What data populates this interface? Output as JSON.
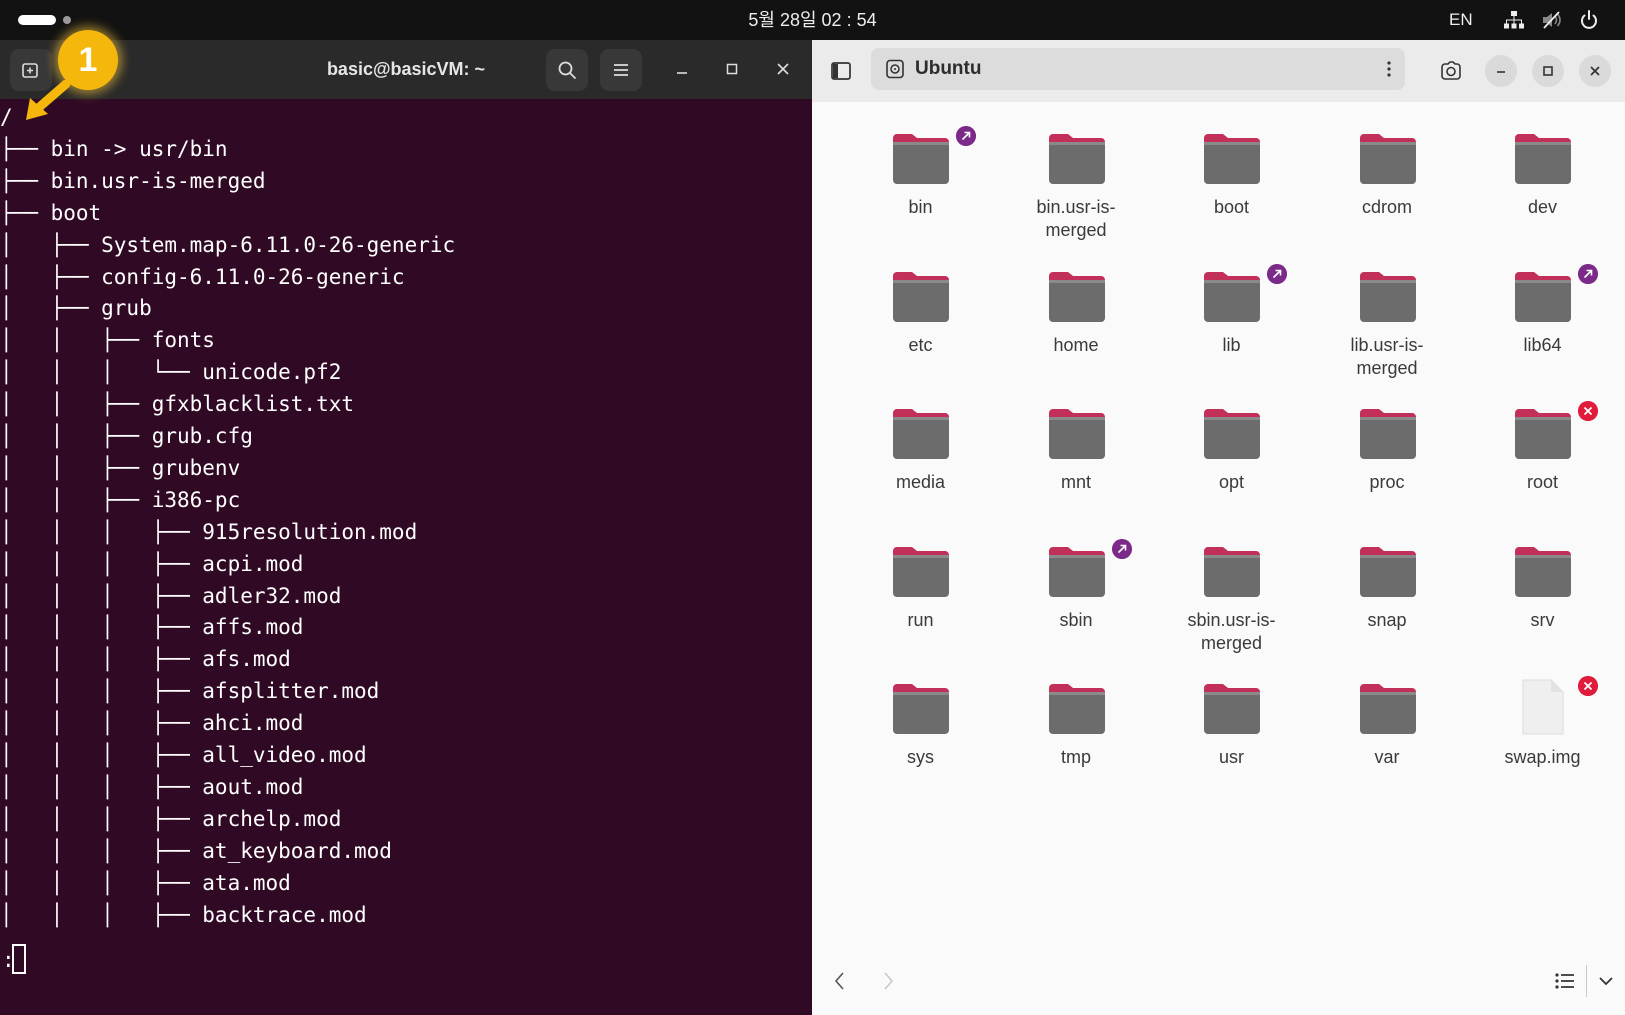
{
  "topbar": {
    "clock": "5월 28일  02 : 54",
    "lang": "EN",
    "tray_icons": [
      "network-icon",
      "volume-muted-icon",
      "power-icon"
    ]
  },
  "terminal": {
    "title": "basic@basicVM: ~",
    "background": "#300a24",
    "prompt": ":",
    "lines": [
      "/",
      "├── bin -> usr/bin",
      "├── bin.usr-is-merged",
      "├── boot",
      "│   ├── System.map-6.11.0-26-generic",
      "│   ├── config-6.11.0-26-generic",
      "│   ├── grub",
      "│   │   ├── fonts",
      "│   │   │   └── unicode.pf2",
      "│   │   ├── gfxblacklist.txt",
      "│   │   ├── grub.cfg",
      "│   │   ├── grubenv",
      "│   │   ├── i386-pc",
      "│   │   │   ├── 915resolution.mod",
      "│   │   │   ├── acpi.mod",
      "│   │   │   ├── adler32.mod",
      "│   │   │   ├── affs.mod",
      "│   │   │   ├── afs.mod",
      "│   │   │   ├── afsplitter.mod",
      "│   │   │   ├── ahci.mod",
      "│   │   │   ├── all_video.mod",
      "│   │   │   ├── aout.mod",
      "│   │   │   ├── archelp.mod",
      "│   │   │   ├── at_keyboard.mod",
      "│   │   │   ├── ata.mod",
      "│   │   │   ├── backtrace.mod"
    ]
  },
  "files": {
    "location": "Ubuntu",
    "items": [
      {
        "name": "bin",
        "type": "folder",
        "emblem": "link"
      },
      {
        "name": "bin.usr-is-\nmerged",
        "type": "folder",
        "emblem": ""
      },
      {
        "name": "boot",
        "type": "folder",
        "emblem": ""
      },
      {
        "name": "cdrom",
        "type": "folder",
        "emblem": ""
      },
      {
        "name": "dev",
        "type": "folder",
        "emblem": ""
      },
      {
        "name": "etc",
        "type": "folder",
        "emblem": ""
      },
      {
        "name": "home",
        "type": "folder",
        "emblem": ""
      },
      {
        "name": "lib",
        "type": "folder",
        "emblem": "link"
      },
      {
        "name": "lib.usr-is-\nmerged",
        "type": "folder",
        "emblem": ""
      },
      {
        "name": "lib64",
        "type": "folder",
        "emblem": "link"
      },
      {
        "name": "media",
        "type": "folder",
        "emblem": ""
      },
      {
        "name": "mnt",
        "type": "folder",
        "emblem": ""
      },
      {
        "name": "opt",
        "type": "folder",
        "emblem": ""
      },
      {
        "name": "proc",
        "type": "folder",
        "emblem": ""
      },
      {
        "name": "root",
        "type": "folder",
        "emblem": "locked"
      },
      {
        "name": "run",
        "type": "folder",
        "emblem": ""
      },
      {
        "name": "sbin",
        "type": "folder",
        "emblem": "link"
      },
      {
        "name": "sbin.usr-is-\nmerged",
        "type": "folder",
        "emblem": ""
      },
      {
        "name": "snap",
        "type": "folder",
        "emblem": ""
      },
      {
        "name": "srv",
        "type": "folder",
        "emblem": ""
      },
      {
        "name": "sys",
        "type": "folder",
        "emblem": ""
      },
      {
        "name": "tmp",
        "type": "folder",
        "emblem": ""
      },
      {
        "name": "usr",
        "type": "folder",
        "emblem": ""
      },
      {
        "name": "var",
        "type": "folder",
        "emblem": ""
      },
      {
        "name": "swap.img",
        "type": "file",
        "emblem": "locked"
      }
    ]
  },
  "overlay": {
    "step_number": "1",
    "marker_color": "#f6b70c"
  },
  "colors": {
    "folder_body": "#6c6c6c",
    "folder_tab": "#c2305a",
    "emblem_link": "#7b2a8a",
    "emblem_locked": "#e01b3c"
  }
}
